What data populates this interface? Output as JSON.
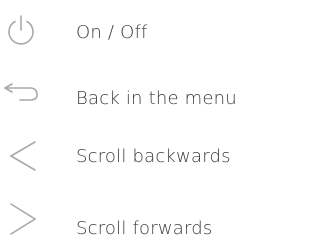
{
  "legend": {
    "items": [
      {
        "icon": "power-icon",
        "label": "On / Off"
      },
      {
        "icon": "back-arrow-icon",
        "label": "Back in the menu"
      },
      {
        "icon": "chevron-left-icon",
        "label": "Scroll backwards"
      },
      {
        "icon": "chevron-right-icon",
        "label": "Scroll forwards"
      }
    ],
    "icon_color": "#a8a8a8",
    "text_color": "#3a3a3a"
  }
}
